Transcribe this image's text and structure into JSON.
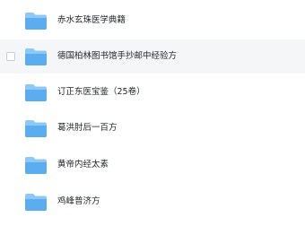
{
  "files": [
    {
      "name": "赤水玄珠医学典籍",
      "icon": "folder-icon"
    },
    {
      "name": "德国柏林图书馆手抄邮中经验方",
      "icon": "folder-icon",
      "hovered": true
    },
    {
      "name": "订正东医宝鉴（25卷）",
      "icon": "folder-icon"
    },
    {
      "name": "葛洪肘后一百方",
      "icon": "folder-icon"
    },
    {
      "name": "黄帝内经太素",
      "icon": "folder-icon"
    },
    {
      "name": "鸡峰普济方",
      "icon": "folder-icon"
    }
  ],
  "colors": {
    "folder_light": "#8ec8f7",
    "folder_main": "#5aaef0",
    "hover_bg": "#f5f6f8",
    "text": "#1f2329"
  }
}
